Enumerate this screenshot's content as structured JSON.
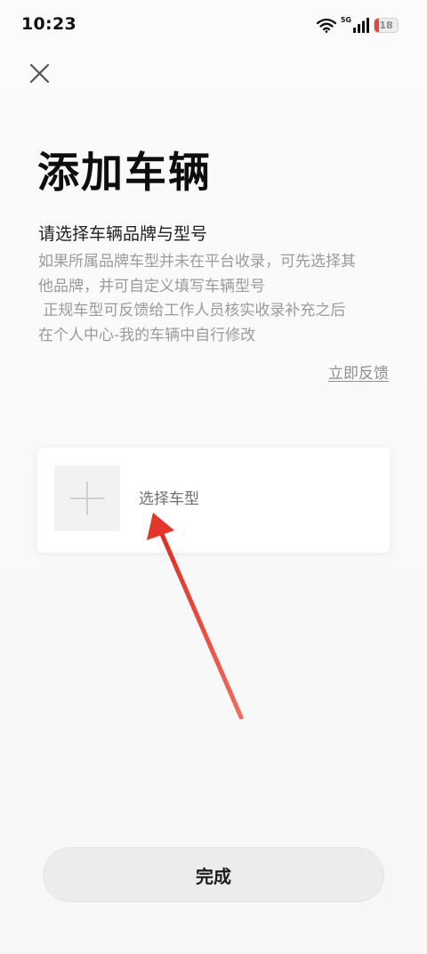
{
  "status_bar": {
    "time": "10:23",
    "network_type": "5G",
    "battery_level": "18",
    "battery_color": "#e8463a",
    "icons": [
      "wifi-icon",
      "signal-icon",
      "battery-icon"
    ]
  },
  "header": {
    "close_icon": "close-icon"
  },
  "page": {
    "title": "添加车辆",
    "subtitle": "请选择车辆品牌与型号",
    "description_lines": [
      "如果所属品牌车型并未在平台收录，可先选择其",
      "他品牌，并可自定义填写车辆型号",
      " 正规车型可反馈给工作人员核实收录补充之后",
      "在个人中心-我的车辆中自行修改"
    ],
    "feedback_link": "立即反馈"
  },
  "vehicle_card": {
    "add_icon": "plus-icon",
    "label": "选择车型"
  },
  "footer": {
    "done_label": "完成"
  },
  "colors": {
    "background": "#f7f7f7",
    "annotation_arrow": "#e63a2e"
  }
}
